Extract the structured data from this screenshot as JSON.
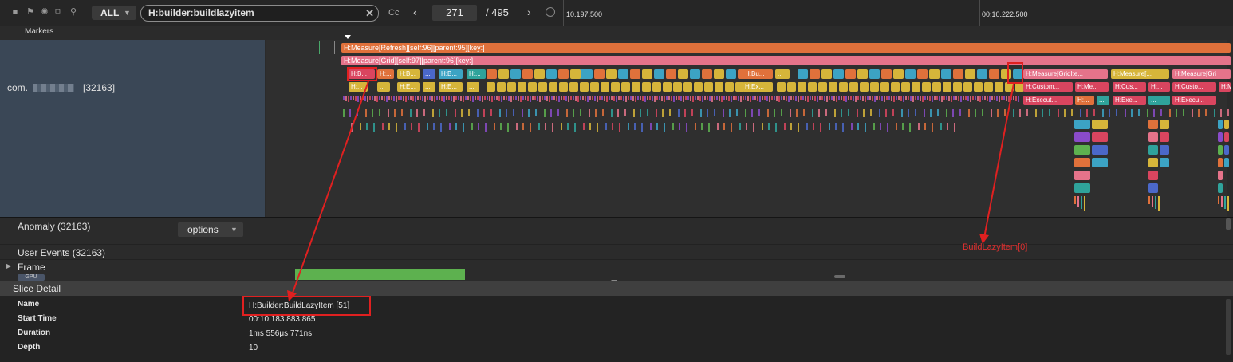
{
  "toolbar": {
    "filter_value": "ALL",
    "search_value": "H:builder:buildlazyitem",
    "case_label": "Cc",
    "current_index": "271",
    "total": "/ 495",
    "time_labels": [
      "10.197.500",
      "00:10.222.500"
    ]
  },
  "tracks": {
    "markers_label": "Markers",
    "process_prefix": "com.",
    "process_pid": "[32163]",
    "slices": {
      "measure_refresh": "H:Measure[Refresh][self:96][parent:95][key:]",
      "measure_grid": "H:Measure[Grid][self:97][parent:96][key:]",
      "b_row": [
        "H:B...",
        "H:...",
        "H:B...",
        "...",
        "H:B...",
        "H:...",
        "...",
        "H:Bu...",
        "..."
      ],
      "measure_griditem": [
        "H:Measure[GridIte...",
        "H:Measure[...",
        "H:Measure[Gri"
      ],
      "e_row": [
        "H:...",
        "...",
        "H:E...",
        "...",
        "H:E...",
        "...",
        "H:Ex..."
      ],
      "custom_row": [
        "H:Custom...",
        "H:Me...",
        "H:Cus...",
        "H:...",
        "H:Custo...",
        "H:Me"
      ],
      "execut_row": [
        "H:Execut...",
        "H:...",
        "...",
        "H:Exe...",
        "...",
        "H:Execu..."
      ]
    }
  },
  "rows": {
    "anomaly_label": "Anomaly (32163)",
    "options_label": "options",
    "user_events_label": "User Events (32163)",
    "frame_label": "Frame",
    "gpu_label": "GPU"
  },
  "detail": {
    "title": "Slice Detail",
    "fields": [
      {
        "key": "Name",
        "value": "H:Builder:BuildLazyItem [51]"
      },
      {
        "key": "Start Time",
        "value": "00:10.183.883.865"
      },
      {
        "key": "Duration",
        "value": "1ms 556μs 771ns"
      },
      {
        "key": "Depth",
        "value": "10"
      }
    ]
  },
  "annotation": {
    "label": "BuildLazyItem[0]"
  },
  "colors": {
    "orange": "#e0713b",
    "pink": "#e5738a",
    "teal": "#2fa39b",
    "yellow": "#d6b53a",
    "red": "#d9455f",
    "blue": "#4b68c9",
    "annotation": "#e02020"
  }
}
